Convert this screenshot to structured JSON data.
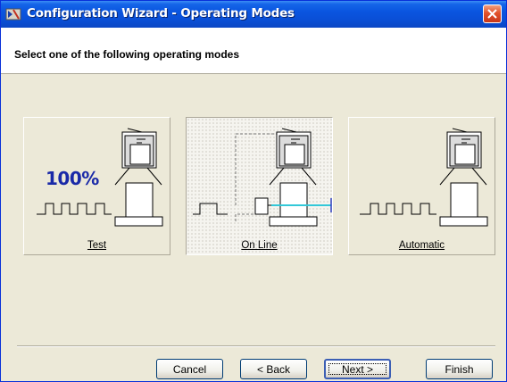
{
  "window": {
    "title": "Configuration Wizard - Operating Modes"
  },
  "header": {
    "instruction": "Select one of the following operating modes"
  },
  "modes": [
    {
      "label": "Test",
      "badge": "100%",
      "selected": false
    },
    {
      "label": "On Line",
      "selected": true
    },
    {
      "label": "Automatic",
      "selected": false
    }
  ],
  "buttons": {
    "cancel": "Cancel",
    "back": "< Back",
    "next": "Next >",
    "finish": "Finish"
  },
  "colors": {
    "title_blue": "#0a55e0",
    "badge_blue": "#1a2aa8",
    "beam_cyan": "#33c8d8",
    "close_red": "#e2522a"
  }
}
